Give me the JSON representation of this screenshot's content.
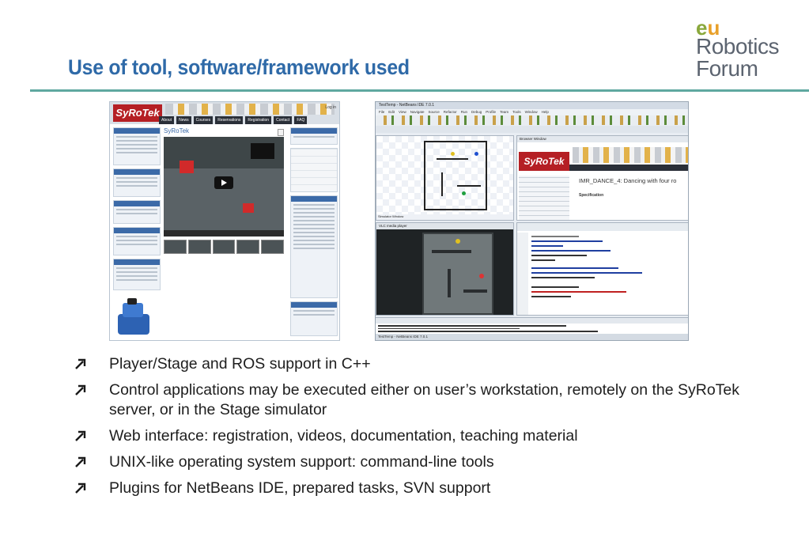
{
  "slide": {
    "title": "Use of tool, software/framework used",
    "accent_color": "#2f6aa8",
    "rule_color": "#5fa8a0"
  },
  "logo": {
    "eu": "eu",
    "line1": "Robotics",
    "line2": "Forum"
  },
  "web_screenshot": {
    "brand": "SyRoTek",
    "page_title": "SyRoTek",
    "nav": [
      "About",
      "News",
      "Courses",
      "Reservations",
      "Registration",
      "Contact",
      "FAQ"
    ],
    "login": "Log in"
  },
  "ide_screenshot": {
    "window_title": "TestTemp - NetBeans IDE 7.0.1",
    "menu": [
      "File",
      "Edit",
      "View",
      "Navigate",
      "Source",
      "Refactor",
      "Run",
      "Debug",
      "Profile",
      "Team",
      "Tools",
      "Window",
      "Help"
    ],
    "sim_window": "Simulator Window",
    "browser_window": "Browser Window",
    "browser_brand": "SyRoTek",
    "browser_heading": "IMR_DANCE_4: Dancing with four ro",
    "browser_subheading": "Specification",
    "vlc_title": "VLC media player",
    "status": "TestTemp - NetBeans IDE 7.0.1"
  },
  "bullets": [
    "Player/Stage and ROS support in C++",
    "Control applications may be executed either on user’s workstation, remotely on the SyRoTek server, or in the Stage simulator",
    "Web interface: registration, videos, documentation, teaching material",
    "UNIX-like operating system support: command-line tools",
    "Plugins for NetBeans IDE, prepared tasks, SVN support"
  ]
}
